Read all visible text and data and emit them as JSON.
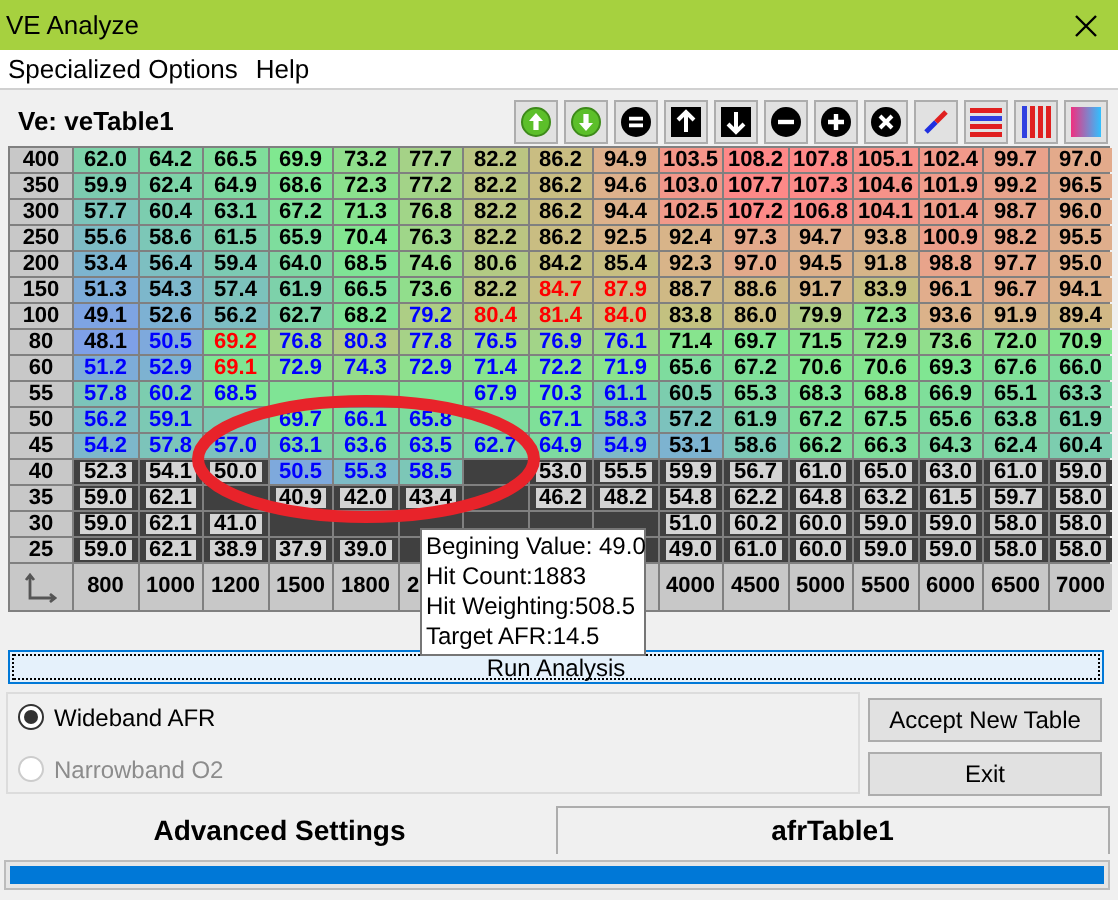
{
  "window": {
    "title": "VE Analyze"
  },
  "menu": [
    "Specialized Options",
    "Help"
  ],
  "table_title": "Ve: veTable1",
  "toolbar": [
    {
      "kind": "circle-up"
    },
    {
      "kind": "circle-down"
    },
    {
      "kind": "equals"
    },
    {
      "kind": "square-up"
    },
    {
      "kind": "square-down"
    },
    {
      "kind": "minus"
    },
    {
      "kind": "plus"
    },
    {
      "kind": "cross"
    },
    {
      "kind": "diagonal"
    },
    {
      "kind": "hstripes"
    },
    {
      "kind": "vstripes"
    },
    {
      "kind": "gradient"
    }
  ],
  "table": {
    "rows": [
      {
        "label": "400",
        "cells": [
          {
            "kind": "value",
            "value": "62.0",
            "color": "#000000"
          },
          {
            "kind": "value",
            "value": "64.2",
            "color": "#000000"
          },
          {
            "kind": "value",
            "value": "66.5",
            "color": "#000000"
          },
          {
            "kind": "value",
            "value": "69.9",
            "color": "#000000"
          },
          {
            "kind": "value",
            "value": "73.2",
            "color": "#000000"
          },
          {
            "kind": "value",
            "value": "77.7",
            "color": "#000000"
          },
          {
            "kind": "value",
            "value": "82.2",
            "color": "#000000"
          },
          {
            "kind": "value",
            "value": "86.2",
            "color": "#000000"
          },
          {
            "kind": "value",
            "value": "94.9",
            "color": "#000000"
          },
          {
            "kind": "value",
            "value": "103.5",
            "color": "#000000"
          },
          {
            "kind": "value",
            "value": "108.2",
            "color": "#000000"
          },
          {
            "kind": "value",
            "value": "107.8",
            "color": "#000000"
          },
          {
            "kind": "value",
            "value": "105.1",
            "color": "#000000"
          },
          {
            "kind": "value",
            "value": "102.4",
            "color": "#000000"
          },
          {
            "kind": "value",
            "value": "99.7",
            "color": "#000000"
          },
          {
            "kind": "value",
            "value": "97.0",
            "color": "#000000"
          }
        ]
      },
      {
        "label": "350",
        "cells": [
          {
            "kind": "value",
            "value": "59.9",
            "color": "#000000"
          },
          {
            "kind": "value",
            "value": "62.4",
            "color": "#000000"
          },
          {
            "kind": "value",
            "value": "64.9",
            "color": "#000000"
          },
          {
            "kind": "value",
            "value": "68.6",
            "color": "#000000"
          },
          {
            "kind": "value",
            "value": "72.3",
            "color": "#000000"
          },
          {
            "kind": "value",
            "value": "77.2",
            "color": "#000000"
          },
          {
            "kind": "value",
            "value": "82.2",
            "color": "#000000"
          },
          {
            "kind": "value",
            "value": "86.2",
            "color": "#000000"
          },
          {
            "kind": "value",
            "value": "94.6",
            "color": "#000000"
          },
          {
            "kind": "value",
            "value": "103.0",
            "color": "#000000"
          },
          {
            "kind": "value",
            "value": "107.7",
            "color": "#000000"
          },
          {
            "kind": "value",
            "value": "107.3",
            "color": "#000000"
          },
          {
            "kind": "value",
            "value": "104.6",
            "color": "#000000"
          },
          {
            "kind": "value",
            "value": "101.9",
            "color": "#000000"
          },
          {
            "kind": "value",
            "value": "99.2",
            "color": "#000000"
          },
          {
            "kind": "value",
            "value": "96.5",
            "color": "#000000"
          }
        ]
      },
      {
        "label": "300",
        "cells": [
          {
            "kind": "value",
            "value": "57.7",
            "color": "#000000"
          },
          {
            "kind": "value",
            "value": "60.4",
            "color": "#000000"
          },
          {
            "kind": "value",
            "value": "63.1",
            "color": "#000000"
          },
          {
            "kind": "value",
            "value": "67.2",
            "color": "#000000"
          },
          {
            "kind": "value",
            "value": "71.3",
            "color": "#000000"
          },
          {
            "kind": "value",
            "value": "76.8",
            "color": "#000000"
          },
          {
            "kind": "value",
            "value": "82.2",
            "color": "#000000"
          },
          {
            "kind": "value",
            "value": "86.2",
            "color": "#000000"
          },
          {
            "kind": "value",
            "value": "94.4",
            "color": "#000000"
          },
          {
            "kind": "value",
            "value": "102.5",
            "color": "#000000"
          },
          {
            "kind": "value",
            "value": "107.2",
            "color": "#000000"
          },
          {
            "kind": "value",
            "value": "106.8",
            "color": "#000000"
          },
          {
            "kind": "value",
            "value": "104.1",
            "color": "#000000"
          },
          {
            "kind": "value",
            "value": "101.4",
            "color": "#000000"
          },
          {
            "kind": "value",
            "value": "98.7",
            "color": "#000000"
          },
          {
            "kind": "value",
            "value": "96.0",
            "color": "#000000"
          }
        ]
      },
      {
        "label": "250",
        "cells": [
          {
            "kind": "value",
            "value": "55.6",
            "color": "#000000"
          },
          {
            "kind": "value",
            "value": "58.6",
            "color": "#000000"
          },
          {
            "kind": "value",
            "value": "61.5",
            "color": "#000000"
          },
          {
            "kind": "value",
            "value": "65.9",
            "color": "#000000"
          },
          {
            "kind": "value",
            "value": "70.4",
            "color": "#000000"
          },
          {
            "kind": "value",
            "value": "76.3",
            "color": "#000000"
          },
          {
            "kind": "value",
            "value": "82.2",
            "color": "#000000"
          },
          {
            "kind": "value",
            "value": "86.2",
            "color": "#000000"
          },
          {
            "kind": "value",
            "value": "92.5",
            "color": "#000000"
          },
          {
            "kind": "value",
            "value": "92.4",
            "color": "#000000"
          },
          {
            "kind": "value",
            "value": "97.3",
            "color": "#000000"
          },
          {
            "kind": "value",
            "value": "94.7",
            "color": "#000000"
          },
          {
            "kind": "value",
            "value": "93.8",
            "color": "#000000"
          },
          {
            "kind": "value",
            "value": "100.9",
            "color": "#000000"
          },
          {
            "kind": "value",
            "value": "98.2",
            "color": "#000000"
          },
          {
            "kind": "value",
            "value": "95.5",
            "color": "#000000"
          }
        ]
      },
      {
        "label": "200",
        "cells": [
          {
            "kind": "value",
            "value": "53.4",
            "color": "#000000"
          },
          {
            "kind": "value",
            "value": "56.4",
            "color": "#000000"
          },
          {
            "kind": "value",
            "value": "59.4",
            "color": "#000000"
          },
          {
            "kind": "value",
            "value": "64.0",
            "color": "#000000"
          },
          {
            "kind": "value",
            "value": "68.5",
            "color": "#000000"
          },
          {
            "kind": "value",
            "value": "74.6",
            "color": "#000000"
          },
          {
            "kind": "value",
            "value": "80.6",
            "color": "#000000"
          },
          {
            "kind": "value",
            "value": "84.2",
            "color": "#000000"
          },
          {
            "kind": "value",
            "value": "85.4",
            "color": "#000000"
          },
          {
            "kind": "value",
            "value": "92.3",
            "color": "#000000"
          },
          {
            "kind": "value",
            "value": "97.0",
            "color": "#000000"
          },
          {
            "kind": "value",
            "value": "94.5",
            "color": "#000000"
          },
          {
            "kind": "value",
            "value": "91.8",
            "color": "#000000"
          },
          {
            "kind": "value",
            "value": "98.8",
            "color": "#000000"
          },
          {
            "kind": "value",
            "value": "97.7",
            "color": "#000000"
          },
          {
            "kind": "value",
            "value": "95.0",
            "color": "#000000"
          }
        ]
      },
      {
        "label": "150",
        "cells": [
          {
            "kind": "value",
            "value": "51.3",
            "color": "#000000"
          },
          {
            "kind": "value",
            "value": "54.3",
            "color": "#000000"
          },
          {
            "kind": "value",
            "value": "57.4",
            "color": "#000000"
          },
          {
            "kind": "value",
            "value": "61.9",
            "color": "#000000"
          },
          {
            "kind": "value",
            "value": "66.5",
            "color": "#000000"
          },
          {
            "kind": "value",
            "value": "73.6",
            "color": "#000000"
          },
          {
            "kind": "value",
            "value": "82.2",
            "color": "#000000"
          },
          {
            "kind": "value",
            "value": "84.7",
            "color": "#ff0000"
          },
          {
            "kind": "value",
            "value": "87.9",
            "color": "#ff0000"
          },
          {
            "kind": "value",
            "value": "88.7",
            "color": "#000000"
          },
          {
            "kind": "value",
            "value": "88.6",
            "color": "#000000"
          },
          {
            "kind": "value",
            "value": "91.7",
            "color": "#000000"
          },
          {
            "kind": "value",
            "value": "83.9",
            "color": "#000000"
          },
          {
            "kind": "value",
            "value": "96.1",
            "color": "#000000"
          },
          {
            "kind": "value",
            "value": "96.7",
            "color": "#000000"
          },
          {
            "kind": "value",
            "value": "94.1",
            "color": "#000000"
          }
        ]
      },
      {
        "label": "100",
        "cells": [
          {
            "kind": "value",
            "value": "49.1",
            "color": "#000000"
          },
          {
            "kind": "value",
            "value": "52.6",
            "color": "#000000"
          },
          {
            "kind": "value",
            "value": "56.2",
            "color": "#000000"
          },
          {
            "kind": "value",
            "value": "62.7",
            "color": "#000000"
          },
          {
            "kind": "value",
            "value": "68.2",
            "color": "#000000"
          },
          {
            "kind": "value",
            "value": "79.2",
            "color": "#0000ff"
          },
          {
            "kind": "value",
            "value": "80.4",
            "color": "#ff0000"
          },
          {
            "kind": "value",
            "value": "81.4",
            "color": "#ff0000"
          },
          {
            "kind": "value",
            "value": "84.0",
            "color": "#ff0000"
          },
          {
            "kind": "value",
            "value": "83.8",
            "color": "#000000"
          },
          {
            "kind": "value",
            "value": "86.0",
            "color": "#000000"
          },
          {
            "kind": "value",
            "value": "79.9",
            "color": "#000000"
          },
          {
            "kind": "value",
            "value": "72.3",
            "color": "#000000"
          },
          {
            "kind": "value",
            "value": "93.6",
            "color": "#000000"
          },
          {
            "kind": "value",
            "value": "91.9",
            "color": "#000000"
          },
          {
            "kind": "value",
            "value": "89.4",
            "color": "#000000"
          }
        ]
      },
      {
        "label": "80",
        "cells": [
          {
            "kind": "value",
            "value": "48.1",
            "color": "#000000"
          },
          {
            "kind": "value",
            "value": "50.5",
            "color": "#0000ff"
          },
          {
            "kind": "value",
            "value": "69.2",
            "color": "#ff0000"
          },
          {
            "kind": "value",
            "value": "76.8",
            "color": "#0000ff"
          },
          {
            "kind": "value",
            "value": "80.3",
            "color": "#0000ff"
          },
          {
            "kind": "value",
            "value": "77.8",
            "color": "#0000ff"
          },
          {
            "kind": "value",
            "value": "76.5",
            "color": "#0000ff"
          },
          {
            "kind": "value",
            "value": "76.9",
            "color": "#0000ff"
          },
          {
            "kind": "value",
            "value": "76.1",
            "color": "#0000ff"
          },
          {
            "kind": "value",
            "value": "71.4",
            "color": "#000000"
          },
          {
            "kind": "value",
            "value": "69.7",
            "color": "#000000"
          },
          {
            "kind": "value",
            "value": "71.5",
            "color": "#000000"
          },
          {
            "kind": "value",
            "value": "72.9",
            "color": "#000000"
          },
          {
            "kind": "value",
            "value": "73.6",
            "color": "#000000"
          },
          {
            "kind": "value",
            "value": "72.0",
            "color": "#000000"
          },
          {
            "kind": "value",
            "value": "70.9",
            "color": "#000000"
          }
        ]
      },
      {
        "label": "60",
        "cells": [
          {
            "kind": "value",
            "value": "51.2",
            "color": "#0000ff"
          },
          {
            "kind": "value",
            "value": "52.9",
            "color": "#0000ff"
          },
          {
            "kind": "value",
            "value": "69.1",
            "color": "#ff0000"
          },
          {
            "kind": "value",
            "value": "72.9",
            "color": "#0000ff"
          },
          {
            "kind": "value",
            "value": "74.3",
            "color": "#0000ff"
          },
          {
            "kind": "value",
            "value": "72.9",
            "color": "#0000ff"
          },
          {
            "kind": "value",
            "value": "71.4",
            "color": "#0000ff"
          },
          {
            "kind": "value",
            "value": "72.2",
            "color": "#0000ff"
          },
          {
            "kind": "value",
            "value": "71.9",
            "color": "#0000ff"
          },
          {
            "kind": "value",
            "value": "65.6",
            "color": "#000000"
          },
          {
            "kind": "value",
            "value": "67.2",
            "color": "#000000"
          },
          {
            "kind": "value",
            "value": "70.6",
            "color": "#000000"
          },
          {
            "kind": "value",
            "value": "70.6",
            "color": "#000000"
          },
          {
            "kind": "value",
            "value": "69.3",
            "color": "#000000"
          },
          {
            "kind": "value",
            "value": "67.6",
            "color": "#000000"
          },
          {
            "kind": "value",
            "value": "66.0",
            "color": "#000000"
          }
        ]
      },
      {
        "label": "55",
        "cells": [
          {
            "kind": "value",
            "value": "57.8",
            "color": "#0000ff"
          },
          {
            "kind": "value",
            "value": "60.2",
            "color": "#0000ff"
          },
          {
            "kind": "value",
            "value": "68.5",
            "color": "#0000ff"
          },
          {
            "kind": "covered"
          },
          {
            "kind": "covered"
          },
          {
            "kind": "covered"
          },
          {
            "kind": "value",
            "value": "67.9",
            "color": "#0000ff"
          },
          {
            "kind": "value",
            "value": "70.3",
            "color": "#0000ff"
          },
          {
            "kind": "value",
            "value": "61.1",
            "color": "#0000ff"
          },
          {
            "kind": "value",
            "value": "60.5",
            "color": "#000000"
          },
          {
            "kind": "value",
            "value": "65.3",
            "color": "#000000"
          },
          {
            "kind": "value",
            "value": "68.3",
            "color": "#000000"
          },
          {
            "kind": "value",
            "value": "68.8",
            "color": "#000000"
          },
          {
            "kind": "value",
            "value": "66.9",
            "color": "#000000"
          },
          {
            "kind": "value",
            "value": "65.1",
            "color": "#000000"
          },
          {
            "kind": "value",
            "value": "63.3",
            "color": "#000000"
          }
        ]
      },
      {
        "label": "50",
        "cells": [
          {
            "kind": "value",
            "value": "56.2",
            "color": "#0000ff"
          },
          {
            "kind": "value",
            "value": "59.1",
            "color": "#0000ff"
          },
          {
            "kind": "covered"
          },
          {
            "kind": "value",
            "value": "69.7",
            "color": "#0000ff"
          },
          {
            "kind": "value",
            "value": "66.1",
            "color": "#0000ff"
          },
          {
            "kind": "value",
            "value": "65.8",
            "color": "#0000ff"
          },
          {
            "kind": "covered"
          },
          {
            "kind": "value",
            "value": "67.1",
            "color": "#0000ff"
          },
          {
            "kind": "value",
            "value": "58.3",
            "color": "#0000ff"
          },
          {
            "kind": "value",
            "value": "57.2",
            "color": "#000000"
          },
          {
            "kind": "value",
            "value": "61.9",
            "color": "#000000"
          },
          {
            "kind": "value",
            "value": "67.2",
            "color": "#000000"
          },
          {
            "kind": "value",
            "value": "67.5",
            "color": "#000000"
          },
          {
            "kind": "value",
            "value": "65.6",
            "color": "#000000"
          },
          {
            "kind": "value",
            "value": "63.8",
            "color": "#000000"
          },
          {
            "kind": "value",
            "value": "61.9",
            "color": "#000000"
          }
        ]
      },
      {
        "label": "45",
        "cells": [
          {
            "kind": "value",
            "value": "54.2",
            "color": "#0000ff"
          },
          {
            "kind": "value",
            "value": "57.8",
            "color": "#0000ff"
          },
          {
            "kind": "value",
            "value": "57.0",
            "color": "#0000ff"
          },
          {
            "kind": "value",
            "value": "63.1",
            "color": "#0000ff"
          },
          {
            "kind": "value",
            "value": "63.6",
            "color": "#0000ff"
          },
          {
            "kind": "value",
            "value": "63.5",
            "color": "#0000ff"
          },
          {
            "kind": "value",
            "value": "62.7",
            "color": "#0000ff"
          },
          {
            "kind": "value",
            "value": "64.9",
            "color": "#0000ff"
          },
          {
            "kind": "value",
            "value": "54.9",
            "color": "#0000ff"
          },
          {
            "kind": "value",
            "value": "53.1",
            "color": "#000000"
          },
          {
            "kind": "value",
            "value": "58.6",
            "color": "#000000"
          },
          {
            "kind": "value",
            "value": "66.2",
            "color": "#000000"
          },
          {
            "kind": "value",
            "value": "66.3",
            "color": "#000000"
          },
          {
            "kind": "value",
            "value": "64.3",
            "color": "#000000"
          },
          {
            "kind": "value",
            "value": "62.4",
            "color": "#000000"
          },
          {
            "kind": "value",
            "value": "60.4",
            "color": "#000000"
          }
        ]
      },
      {
        "label": "40",
        "cells": [
          {
            "kind": "value",
            "value": "52.3",
            "color": "#000000",
            "locked": true
          },
          {
            "kind": "value",
            "value": "54.1",
            "color": "#000000",
            "locked": true
          },
          {
            "kind": "value",
            "value": "50.0",
            "color": "#000000",
            "locked": true
          },
          {
            "kind": "value",
            "value": "50.5",
            "color": "#0000ff",
            "locked": false
          },
          {
            "kind": "value",
            "value": "55.3",
            "color": "#0000ff",
            "locked": false
          },
          {
            "kind": "value",
            "value": "58.5",
            "color": "#0000ff",
            "locked": false
          },
          {
            "kind": "covered",
            "locked": true
          },
          {
            "kind": "value",
            "value": "53.0",
            "color": "#000000",
            "locked": true
          },
          {
            "kind": "value",
            "value": "55.5",
            "color": "#000000",
            "locked": true
          },
          {
            "kind": "value",
            "value": "59.9",
            "color": "#000000",
            "locked": true
          },
          {
            "kind": "value",
            "value": "56.7",
            "color": "#000000",
            "locked": true
          },
          {
            "kind": "value",
            "value": "61.0",
            "color": "#000000",
            "locked": true
          },
          {
            "kind": "value",
            "value": "65.0",
            "color": "#000000",
            "locked": true
          },
          {
            "kind": "value",
            "value": "63.0",
            "color": "#000000",
            "locked": true
          },
          {
            "kind": "value",
            "value": "61.0",
            "color": "#000000",
            "locked": true
          },
          {
            "kind": "value",
            "value": "59.0",
            "color": "#000000",
            "locked": true
          }
        ]
      },
      {
        "label": "35",
        "cells": [
          {
            "kind": "value",
            "value": "59.0",
            "color": "#000000",
            "locked": true
          },
          {
            "kind": "value",
            "value": "62.1",
            "color": "#000000",
            "locked": true
          },
          {
            "kind": "covered",
            "locked": true
          },
          {
            "kind": "value",
            "value": "40.9",
            "color": "#000000",
            "locked": true
          },
          {
            "kind": "value",
            "value": "42.0",
            "color": "#000000",
            "locked": true
          },
          {
            "kind": "value",
            "value": "43.4",
            "color": "#000000",
            "locked": true
          },
          {
            "kind": "covered",
            "locked": true
          },
          {
            "kind": "value",
            "value": "46.2",
            "color": "#000000",
            "locked": true
          },
          {
            "kind": "value",
            "value": "48.2",
            "color": "#000000",
            "locked": true
          },
          {
            "kind": "value",
            "value": "54.8",
            "color": "#000000",
            "locked": true
          },
          {
            "kind": "value",
            "value": "62.2",
            "color": "#000000",
            "locked": true
          },
          {
            "kind": "value",
            "value": "64.8",
            "color": "#000000",
            "locked": true
          },
          {
            "kind": "value",
            "value": "63.2",
            "color": "#000000",
            "locked": true
          },
          {
            "kind": "value",
            "value": "61.5",
            "color": "#000000",
            "locked": true
          },
          {
            "kind": "value",
            "value": "59.7",
            "color": "#000000",
            "locked": true
          },
          {
            "kind": "value",
            "value": "58.0",
            "color": "#000000",
            "locked": true
          }
        ]
      },
      {
        "label": "30",
        "cells": [
          {
            "kind": "value",
            "value": "59.0",
            "color": "#000000",
            "locked": true
          },
          {
            "kind": "value",
            "value": "62.1",
            "color": "#000000",
            "locked": true
          },
          {
            "kind": "value",
            "value": "41.0",
            "color": "#000000",
            "locked": true
          },
          {
            "kind": "covered",
            "locked": true
          },
          {
            "kind": "covered",
            "locked": true
          },
          {
            "kind": "covered",
            "locked": true
          },
          {
            "kind": "covered",
            "locked": true
          },
          {
            "kind": "covered",
            "locked": true
          },
          {
            "kind": "covered",
            "locked": true
          },
          {
            "kind": "value",
            "value": "51.0",
            "color": "#000000",
            "locked": true
          },
          {
            "kind": "value",
            "value": "60.2",
            "color": "#000000",
            "locked": true
          },
          {
            "kind": "value",
            "value": "60.0",
            "color": "#000000",
            "locked": true
          },
          {
            "kind": "value",
            "value": "59.0",
            "color": "#000000",
            "locked": true
          },
          {
            "kind": "value",
            "value": "59.0",
            "color": "#000000",
            "locked": true
          },
          {
            "kind": "value",
            "value": "58.0",
            "color": "#000000",
            "locked": true
          },
          {
            "kind": "value",
            "value": "58.0",
            "color": "#000000",
            "locked": true
          }
        ]
      },
      {
        "label": "25",
        "cells": [
          {
            "kind": "value",
            "value": "59.0",
            "color": "#000000",
            "locked": true
          },
          {
            "kind": "value",
            "value": "62.1",
            "color": "#000000",
            "locked": true
          },
          {
            "kind": "value",
            "value": "38.9",
            "color": "#000000",
            "locked": true
          },
          {
            "kind": "value",
            "value": "37.9",
            "color": "#000000",
            "locked": true
          },
          {
            "kind": "value",
            "value": "39.0",
            "color": "#000000",
            "locked": true
          },
          {
            "kind": "covered",
            "locked": true
          },
          {
            "kind": "hidden"
          },
          {
            "kind": "hidden"
          },
          {
            "kind": "covered",
            "locked": true
          },
          {
            "kind": "value",
            "value": "49.0",
            "color": "#000000",
            "locked": true
          },
          {
            "kind": "value",
            "value": "61.0",
            "color": "#000000",
            "locked": true
          },
          {
            "kind": "value",
            "value": "60.0",
            "color": "#000000",
            "locked": true
          },
          {
            "kind": "value",
            "value": "59.0",
            "color": "#000000",
            "locked": true
          },
          {
            "kind": "value",
            "value": "59.0",
            "color": "#000000",
            "locked": true
          },
          {
            "kind": "value",
            "value": "58.0",
            "color": "#000000",
            "locked": true
          },
          {
            "kind": "value",
            "value": "58.0",
            "color": "#000000",
            "locked": true
          }
        ]
      }
    ]
  },
  "bottom_axis": [
    {
      "kind": "label",
      "label": "800"
    },
    {
      "kind": "label",
      "label": "1000"
    },
    {
      "kind": "label",
      "label": "1200"
    },
    {
      "kind": "label",
      "label": "1500"
    },
    {
      "kind": "label",
      "label": "1800"
    },
    {
      "kind": "label",
      "label": "2"
    },
    {
      "kind": "covered"
    },
    {
      "kind": "hidden"
    },
    {
      "kind": "covered"
    },
    {
      "kind": "label",
      "label": "4000"
    },
    {
      "kind": "label",
      "label": "4500"
    },
    {
      "kind": "label",
      "label": "5000"
    },
    {
      "kind": "label",
      "label": "5500"
    },
    {
      "kind": "label",
      "label": "6000"
    },
    {
      "kind": "label",
      "label": "6500"
    },
    {
      "kind": "label",
      "label": "7000"
    }
  ],
  "tooltip": {
    "lines": [
      "Begining Value: 49.0",
      "Hit Count:1883",
      "Hit Weighting:508.5",
      "Target AFR:14.5"
    ]
  },
  "run_button": "Run Analysis",
  "sensor_options": [
    {
      "label": "Wideband AFR",
      "selected": true,
      "disabled": false
    },
    {
      "label": "Narrowband O2",
      "selected": false,
      "disabled": true
    }
  ],
  "buttons": [
    "Accept New Table",
    "Exit"
  ],
  "tabs": [
    {
      "label": "Advanced Settings",
      "selected": true
    },
    {
      "label": "afrTable1",
      "selected": false
    }
  ],
  "progress": {
    "level": 1
  }
}
